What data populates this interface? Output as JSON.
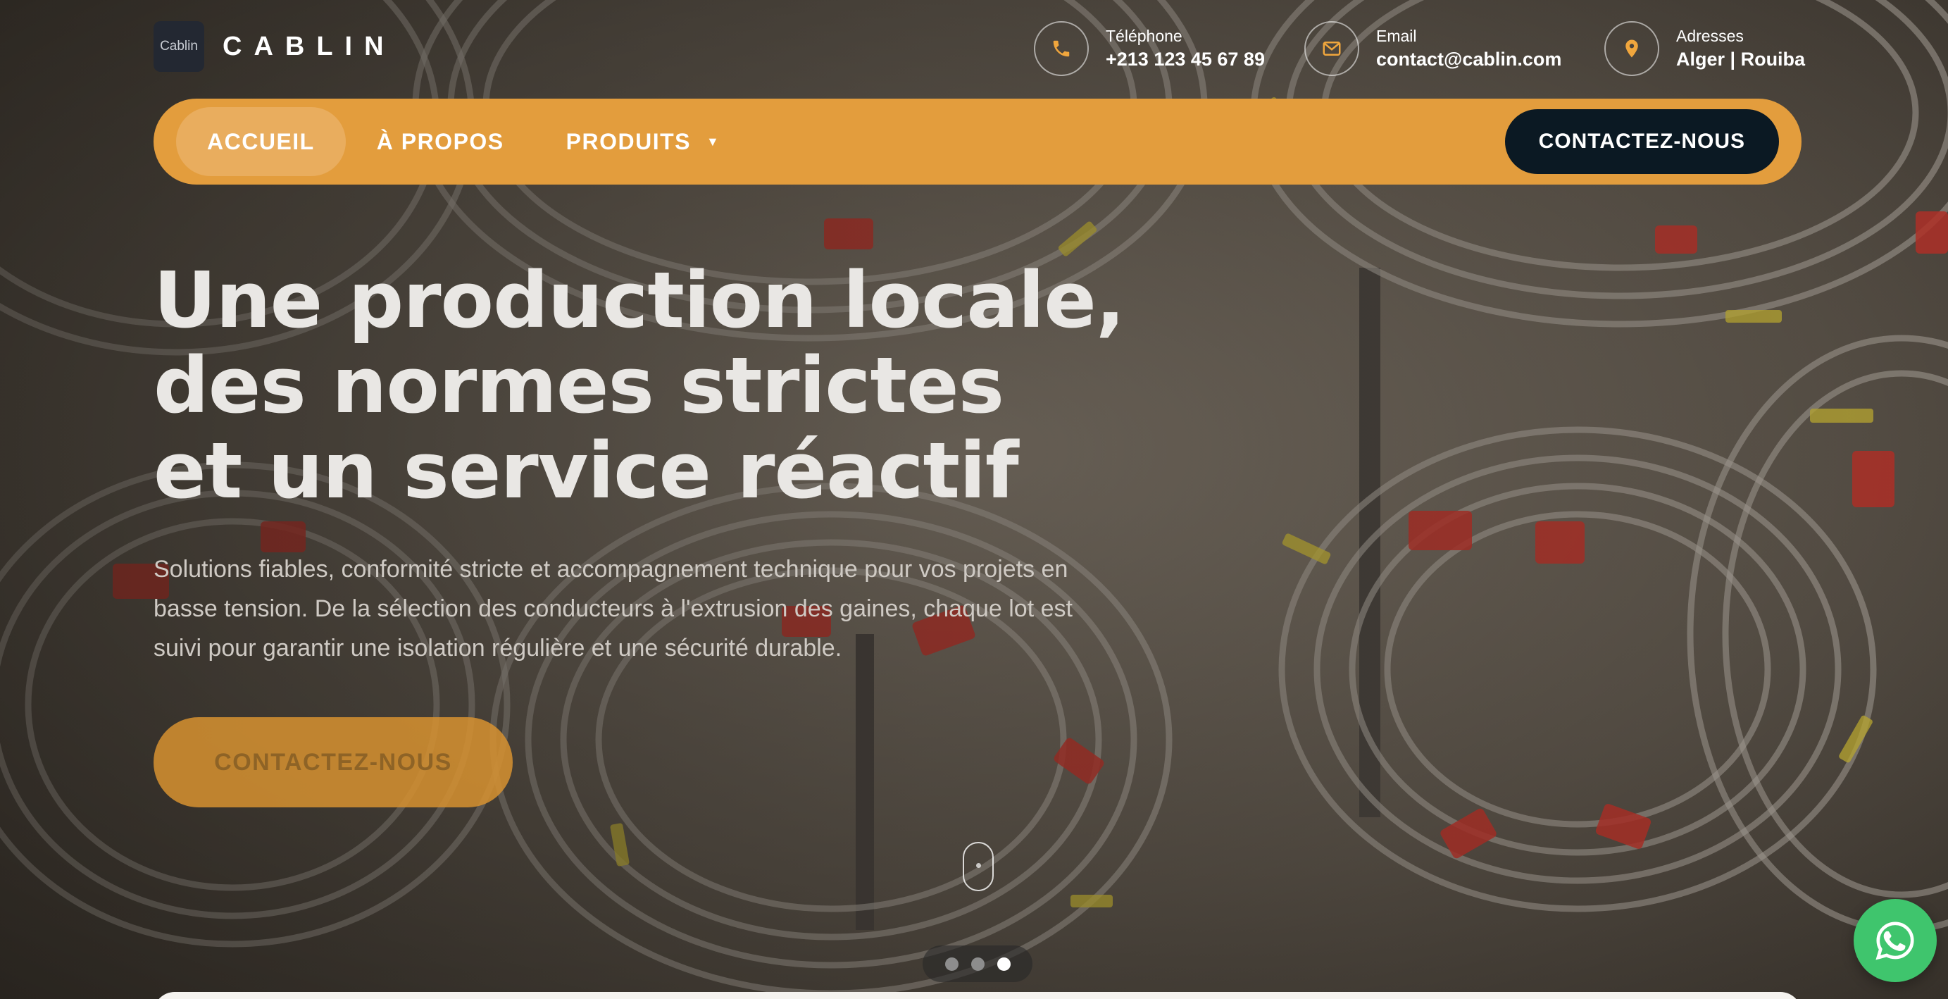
{
  "brand": {
    "logo_text": "Cablin",
    "name": "CABLIN"
  },
  "contacts": [
    {
      "label": "Téléphone",
      "value": "+213 123 45 67 89",
      "icon": "phone-icon"
    },
    {
      "label": "Email",
      "value": "contact@cablin.com",
      "icon": "mail-icon"
    },
    {
      "label": "Adresses",
      "value": "Alger | Rouiba",
      "icon": "location-pin-icon"
    }
  ],
  "nav": {
    "items": [
      {
        "label": "ACCUEIL",
        "active": true
      },
      {
        "label": "À PROPOS",
        "active": false
      },
      {
        "label": "PRODUITS",
        "active": false,
        "dropdown": true
      }
    ],
    "caret": "▼",
    "cta_label": "CONTACTEZ-NOUS"
  },
  "hero": {
    "headline_lines": [
      "Une production locale,",
      "des normes strictes",
      "et un service réactif"
    ],
    "subtext": "Solutions fiables, conformité stricte et accompagnement technique pour vos projets en basse tension. De la sélection des conducteurs à l'extrusion des gaines, chaque lot est suivi pour garantir une isolation régulière et une sécurité durable.",
    "cta_label": "CONTACTEZ-NOUS"
  },
  "slider": {
    "total": 3,
    "active_index": 2
  },
  "colors": {
    "accent": "#e39d3d",
    "dark": "#0b1923",
    "whatsapp": "#3fc56d",
    "icon_accent": "#f0a63d"
  }
}
